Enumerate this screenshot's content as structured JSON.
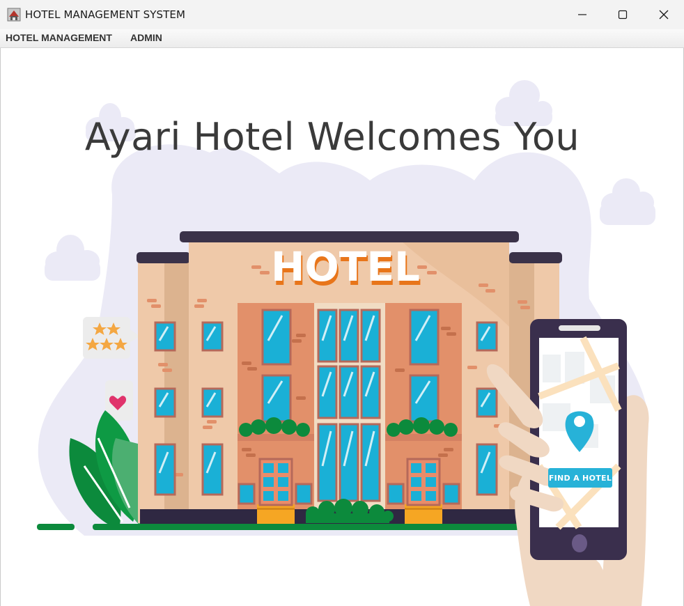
{
  "window": {
    "title": "HOTEL MANAGEMENT SYSTEM",
    "controls": {
      "minimize": "minimize-icon",
      "maximize": "maximize-icon",
      "close": "close-icon"
    }
  },
  "menu": {
    "items": [
      {
        "label": "HOTEL MANAGEMENT"
      },
      {
        "label": "ADMIN"
      }
    ]
  },
  "main": {
    "heading": "Ayari Hotel Welcomes You",
    "sign_text": "HOTEL",
    "phone_button": "FIND A HOTEL"
  },
  "colors": {
    "title_bar": "#f3f3f3",
    "blob": "#ebeaf6",
    "facade": "#efc9a9",
    "brick": "#e2906a",
    "roof": "#3a3249",
    "window": "#1ab0d6",
    "plant": "#0c8a3c",
    "phone": "#3a2f4d",
    "skin": "#f0d8c3",
    "accent": "#27b2d8"
  }
}
